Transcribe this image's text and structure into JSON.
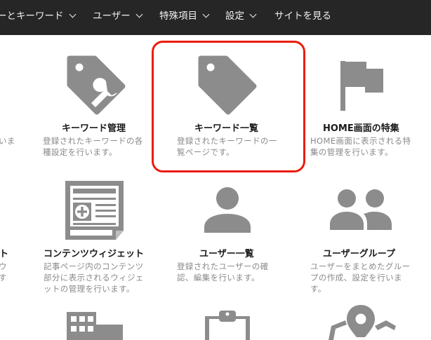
{
  "nav": {
    "items": [
      {
        "label": "ーとキーワード",
        "has_dropdown": true
      },
      {
        "label": "ユーザー",
        "has_dropdown": true
      },
      {
        "label": "特殊項目",
        "has_dropdown": true
      },
      {
        "label": "設定",
        "has_dropdown": true
      },
      {
        "label": "サイトを見る",
        "has_dropdown": false
      }
    ]
  },
  "tiles": {
    "left_partial_1": {
      "desc_l1": "いま"
    },
    "keyword_manage": {
      "icon": "wrench-tag-icon",
      "title": "キーワード管理",
      "desc_l1": "登録されたキーワードの各",
      "desc_l2": "種設定を行います。"
    },
    "keyword_list": {
      "icon": "tag-icon",
      "title": "キーワード一覧",
      "desc_l1": "登録されたキーワードの一",
      "desc_l2": "覧ページです。"
    },
    "home_feature": {
      "icon": "flag-icon",
      "title": "HOME画面の特集",
      "desc_l1": "HOME画面に表示される特",
      "desc_l2": "集の管理を行います。"
    },
    "left_partial_2": {
      "title": "ト",
      "desc_l1": "ウ",
      "desc_l2": "す"
    },
    "content_widget": {
      "icon": "newspaper-plus-icon",
      "title": "コンテンツウィジェット",
      "desc_l1": "記事ページ内のコンテンツ",
      "desc_l2": "部分に表示されるウィジェ",
      "desc_l3": "ットの管理を行います。"
    },
    "user_list": {
      "icon": "user-icon",
      "title": "ユーザー一覧",
      "desc_l1": "登録されたユーザーの確",
      "desc_l2": "認、編集を行います。"
    },
    "user_group": {
      "icon": "user-group-icon",
      "title": "ユーザーグループ",
      "desc_l1": "ユーザーをまとめたグルー",
      "desc_l2": "プの作成、設定を行いま",
      "desc_l3": "す。"
    },
    "row3": [
      {
        "icon": "building-icon"
      },
      {
        "icon": "clipboard-icon"
      },
      {
        "icon": "map-pin-icon"
      }
    ]
  },
  "colors": {
    "accent_highlight": "#ec1c0c",
    "nav_bg": "#262626",
    "icon_gray": "#8c8c8c"
  }
}
